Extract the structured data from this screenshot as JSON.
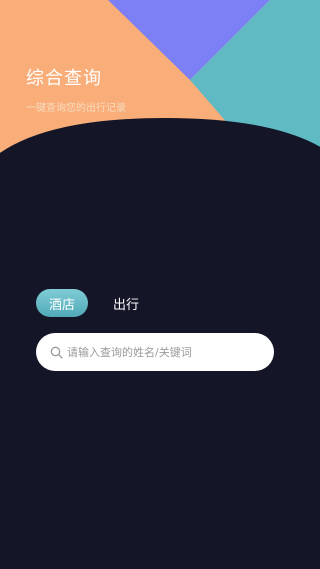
{
  "header": {
    "title": "综合查询",
    "subtitle": "一键查询您的出行记录"
  },
  "tabs": [
    {
      "label": "酒店",
      "active": true
    },
    {
      "label": "出行",
      "active": false
    }
  ],
  "search": {
    "placeholder": "请输入查询的姓名/关键词",
    "value": "",
    "icon": "search-icon"
  },
  "colors": {
    "background": "#141628",
    "orange": "#F9AD78",
    "purple": "#7D7FF5",
    "teal": "#5FBAC4",
    "active_tab": "#6BBFCB"
  }
}
